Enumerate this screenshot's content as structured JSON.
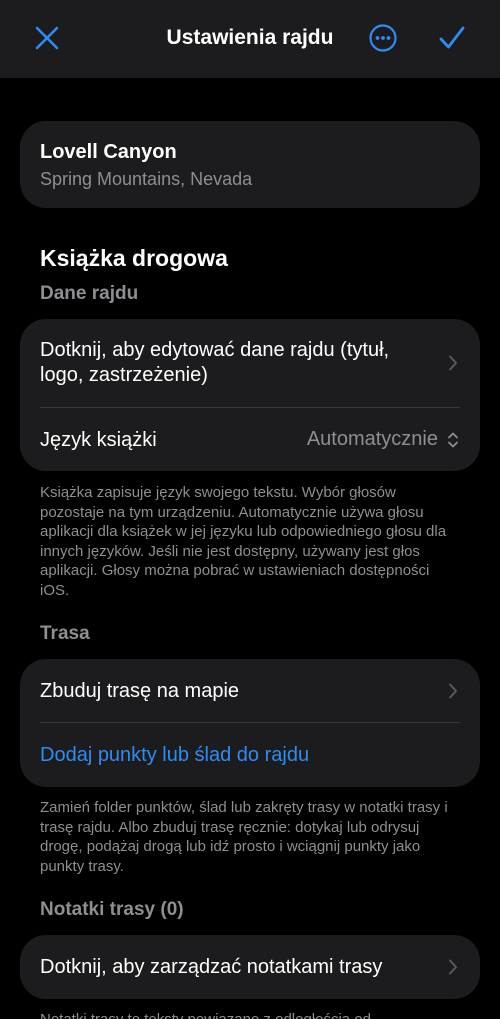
{
  "nav": {
    "title": "Ustawienia rajdu",
    "close_icon": "close-icon",
    "more_icon": "ellipsis-circle-icon",
    "confirm_icon": "checkmark-icon",
    "accent": "#2f8cf2"
  },
  "location": {
    "name": "Lovell Canyon",
    "subtitle": "Spring Mountains, Nevada"
  },
  "roadbook": {
    "title": "Książka drogowa",
    "data_section": "Dane rajdu",
    "edit_label": "Dotknij, aby edytować dane rajdu (tytuł, logo, zastrzeżenie)",
    "language_label": "Język książki",
    "language_value": "Automatycznie",
    "language_footnote": "Książka zapisuje język swojego tekstu. Wybór głosów pozostaje na tym urządzeniu. Automatycznie używa głosu aplikacji dla książek w jej języku lub odpowiedniego głosu dla innych języków. Jeśli nie jest dostępny, używany jest głos aplikacji. Głosy można pobrać w ustawieniach dostępności iOS."
  },
  "route": {
    "section": "Trasa",
    "build_label": "Zbuduj trasę na mapie",
    "add_label": "Dodaj punkty lub ślad do rajdu",
    "footnote": "Zamień folder punktów, ślad lub zakręty trasy w notatki trasy i trasę rajdu. Albo zbuduj trasę ręcznie: dotykaj lub odrysuj drogę, podążaj drogą lub idź prosto i wciągnij punkty jako punkty trasy."
  },
  "notes": {
    "section": "Notatki trasy (0)",
    "manage_label": "Dotknij, aby zarządzać notatkami trasy",
    "footnote": "Notatki trasy to teksty powiązane z odległością od"
  },
  "colors": {
    "background": "#000000",
    "card": "#1c1c1e",
    "secondary_text": "#8e8e93",
    "accent": "#2f8cf2"
  }
}
